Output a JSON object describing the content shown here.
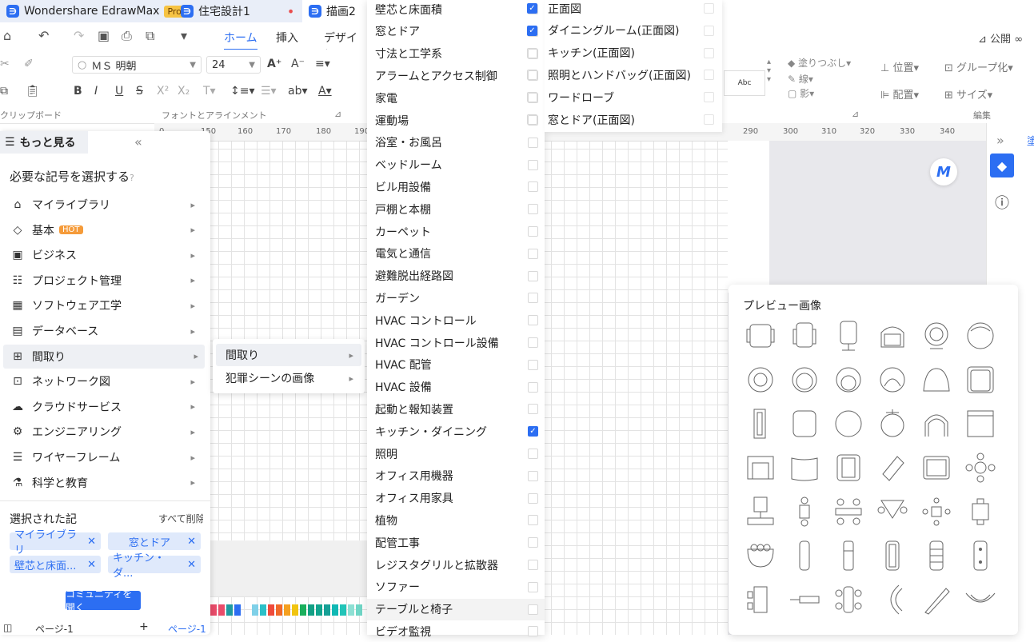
{
  "titlebar": {
    "app_name": "Wondershare EdrawMax",
    "pro_badge": "Pro",
    "tabs": [
      {
        "label": "住宅設計1",
        "modified": "•"
      },
      {
        "label": "描画2"
      }
    ]
  },
  "menu": {
    "tabs": [
      "ホーム",
      "挿入",
      "デザイン"
    ],
    "active": "ホーム",
    "publish": "公開"
  },
  "ribbon": {
    "font_name": "ＭＳ 明朝",
    "font_size": "24",
    "groups": {
      "clipboard": "クリップボード",
      "font": "フォントとアラインメント",
      "edit": "編集"
    },
    "right": {
      "fill": "塗りつぶし",
      "line": "線",
      "shadow": "影",
      "position": "位置",
      "group": "グループ化",
      "align": "配置",
      "size": "サイズ",
      "style_sample": "Abc"
    }
  },
  "ruler": {
    "left_ticks": [
      "0",
      "150",
      "160",
      "170",
      "180",
      "190"
    ],
    "right_ticks": [
      "290",
      "300",
      "310",
      "320",
      "330",
      "340"
    ]
  },
  "left_panel": {
    "more": "もっと見る",
    "heading": "必要な記号を選択する",
    "items": [
      {
        "icon": "⌂",
        "label": "マイライブラリ"
      },
      {
        "icon": "◇",
        "label": "基本",
        "badge": "HOT"
      },
      {
        "icon": "▣",
        "label": "ビジネス"
      },
      {
        "icon": "☷",
        "label": "プロジェクト管理"
      },
      {
        "icon": "▦",
        "label": "ソフトウェア工学"
      },
      {
        "icon": "▤",
        "label": "データベース"
      },
      {
        "icon": "⊞",
        "label": "間取り"
      },
      {
        "icon": "⊡",
        "label": "ネットワーク図"
      },
      {
        "icon": "☁",
        "label": "クラウドサービス"
      },
      {
        "icon": "⚙",
        "label": "エンジニアリング"
      },
      {
        "icon": "☰",
        "label": "ワイヤーフレーム"
      },
      {
        "icon": "⚗",
        "label": "科学と教育"
      }
    ],
    "selected_label": "選択された記",
    "clear_all": "すべて削除",
    "chips": [
      "マイライブラリ",
      "窓とドア",
      "壁芯と床面...",
      "キッチン・ダ..."
    ],
    "community_button": "コミュニティを開く"
  },
  "submenu": {
    "items": [
      "間取り",
      "犯罪シーンの画像"
    ]
  },
  "categories": {
    "items": [
      {
        "label": "壁芯と床面積",
        "checked": false
      },
      {
        "label": "窓とドア",
        "checked": false
      },
      {
        "label": "寸法と工学系",
        "checked": false
      },
      {
        "label": "アラームとアクセス制御",
        "checked": false
      },
      {
        "label": "家電",
        "checked": false
      },
      {
        "label": "運動場",
        "checked": false
      },
      {
        "label": "浴室・お風呂",
        "checked": false
      },
      {
        "label": "ベッドルーム",
        "checked": false
      },
      {
        "label": "ビル用設備",
        "checked": false
      },
      {
        "label": "戸棚と本棚",
        "checked": false
      },
      {
        "label": "カーペット",
        "checked": false
      },
      {
        "label": "電気と通信",
        "checked": false
      },
      {
        "label": "避難脱出経路図",
        "checked": false
      },
      {
        "label": "ガーデン",
        "checked": false
      },
      {
        "label": "HVAC コントロール",
        "checked": false
      },
      {
        "label": "HVAC コントロール設備",
        "checked": false
      },
      {
        "label": "HVAC 配管",
        "checked": false
      },
      {
        "label": "HVAC 設備",
        "checked": false
      },
      {
        "label": "起動と報知装置",
        "checked": false
      },
      {
        "label": "キッチン・ダイニング",
        "checked": true
      },
      {
        "label": "照明",
        "checked": false
      },
      {
        "label": "オフィス用機器",
        "checked": false
      },
      {
        "label": "オフィス用家具",
        "checked": false
      },
      {
        "label": "植物",
        "checked": false
      },
      {
        "label": "配管工事",
        "checked": false
      },
      {
        "label": "レジスタグリルと拡散器",
        "checked": false
      },
      {
        "label": "ソファー",
        "checked": false
      },
      {
        "label": "テーブルと椅子",
        "checked": false
      },
      {
        "label": "ビデオ監視",
        "checked": false
      }
    ]
  },
  "subcategories": {
    "items": [
      {
        "label": "正面図",
        "checked": true
      },
      {
        "label": "ダイニングルーム(正面図)",
        "checked": true
      },
      {
        "label": "キッチン(正面図)",
        "checked": false
      },
      {
        "label": "照明とハンドバッグ(正面図)",
        "checked": false
      },
      {
        "label": "ワードローブ",
        "checked": false
      },
      {
        "label": "窓とドア(正面図)",
        "checked": false
      }
    ]
  },
  "preview": {
    "title": "プレビュー画像"
  },
  "status": {
    "page_label": "ページ-1",
    "page_tab": "ページ-1"
  },
  "colors": {
    "accent": "#2c6ef2",
    "hot": "#f59b3a"
  }
}
